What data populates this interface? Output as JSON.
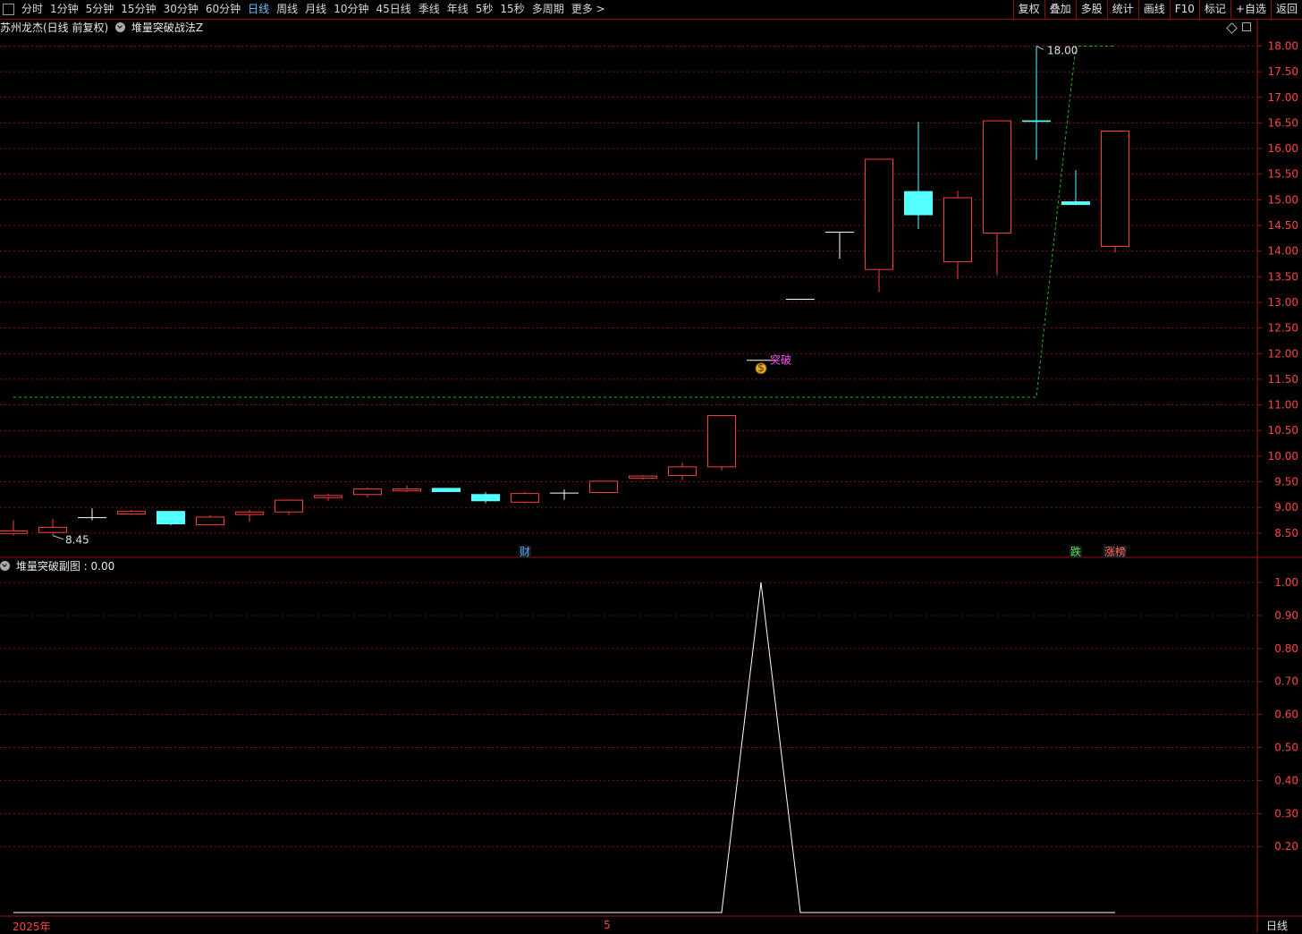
{
  "toolbar": {
    "periods": [
      "分时",
      "1分钟",
      "5分钟",
      "15分钟",
      "30分钟",
      "60分钟",
      "日线",
      "周线",
      "月线",
      "10分钟",
      "45日线",
      "季线",
      "年线",
      "5秒",
      "15秒",
      "多周期",
      "更多 >"
    ],
    "active_period": "日线",
    "right_buttons": [
      "复权",
      "叠加",
      "多股",
      "统计",
      "画线",
      "F10",
      "标记",
      "+自选",
      "返回"
    ]
  },
  "main_panel": {
    "title": "苏州龙杰(日线 前复权)",
    "indicator": "堆量突破战法Z",
    "marker_text": "突破",
    "high_label": "18.00",
    "low_label": "8.45",
    "event_tags": [
      {
        "text": "财",
        "color": "#5aa0ff"
      },
      {
        "text": "跌",
        "color": "#55dd55"
      },
      {
        "text": "涨榜",
        "color": "#ff6666"
      }
    ]
  },
  "sub_panel": {
    "title": "堆量突破副图",
    "value": ": 0.00"
  },
  "x_axis": {
    "labels": [
      "2025年",
      "5"
    ],
    "period_label": "日线"
  },
  "colors": {
    "up": "#ff3b3b",
    "down": "#54ffff",
    "flat": "#ffffff",
    "grid": "#7a1515",
    "border": "#a01010",
    "guide": "#22bb22",
    "signal": "#ff55ff"
  },
  "chart_data": [
    {
      "type": "candlestick",
      "ylim": [
        8.2,
        18.2
      ],
      "y_ticks": [
        8.5,
        9.0,
        9.5,
        10.0,
        10.5,
        11.0,
        11.5,
        12.0,
        12.5,
        13.0,
        13.5,
        14.0,
        14.5,
        15.0,
        15.5,
        16.0,
        16.5,
        17.0,
        17.5,
        18.0
      ],
      "candles": [
        {
          "o": 8.5,
          "h": 8.75,
          "l": 8.45,
          "c": 8.55
        },
        {
          "o": 8.52,
          "h": 8.78,
          "l": 8.45,
          "c": 8.62
        },
        {
          "o": 8.8,
          "h": 8.98,
          "l": 8.75,
          "c": 8.8
        },
        {
          "o": 8.88,
          "h": 8.95,
          "l": 8.85,
          "c": 8.93
        },
        {
          "o": 8.93,
          "h": 8.93,
          "l": 8.65,
          "c": 8.67
        },
        {
          "o": 8.67,
          "h": 8.85,
          "l": 8.65,
          "c": 8.82
        },
        {
          "o": 8.87,
          "h": 8.95,
          "l": 8.72,
          "c": 8.92
        },
        {
          "o": 8.92,
          "h": 9.15,
          "l": 8.85,
          "c": 9.15
        },
        {
          "o": 9.2,
          "h": 9.27,
          "l": 9.13,
          "c": 9.24
        },
        {
          "o": 9.26,
          "h": 9.39,
          "l": 9.2,
          "c": 9.37
        },
        {
          "o": 9.33,
          "h": 9.43,
          "l": 9.3,
          "c": 9.37
        },
        {
          "o": 9.38,
          "h": 9.38,
          "l": 9.3,
          "c": 9.3
        },
        {
          "o": 9.26,
          "h": 9.3,
          "l": 9.08,
          "c": 9.12
        },
        {
          "o": 9.11,
          "h": 9.3,
          "l": 9.08,
          "c": 9.28
        },
        {
          "o": 9.28,
          "h": 9.35,
          "l": 9.15,
          "c": 9.28
        },
        {
          "o": 9.3,
          "h": 9.52,
          "l": 9.29,
          "c": 9.52
        },
        {
          "o": 9.58,
          "h": 9.63,
          "l": 9.54,
          "c": 9.62
        },
        {
          "o": 9.63,
          "h": 9.88,
          "l": 9.53,
          "c": 9.8
        },
        {
          "o": 9.8,
          "h": 10.8,
          "l": 9.72,
          "c": 10.8
        },
        {
          "o": 11.87,
          "h": 11.87,
          "l": 11.87,
          "c": 11.87
        },
        {
          "o": 13.06,
          "h": 13.06,
          "l": 13.06,
          "c": 13.06
        },
        {
          "o": 14.37,
          "h": 14.37,
          "l": 13.85,
          "c": 14.37
        },
        {
          "o": 13.65,
          "h": 15.8,
          "l": 13.2,
          "c": 15.8
        },
        {
          "o": 15.17,
          "h": 16.52,
          "l": 14.43,
          "c": 14.7
        },
        {
          "o": 13.8,
          "h": 15.18,
          "l": 13.45,
          "c": 15.05
        },
        {
          "o": 14.36,
          "h": 16.55,
          "l": 13.53,
          "c": 16.55
        },
        {
          "o": 16.55,
          "h": 18.0,
          "l": 15.78,
          "c": 16.52
        },
        {
          "o": 14.97,
          "h": 15.58,
          "l": 14.9,
          "c": 14.9
        },
        {
          "o": 14.1,
          "h": 16.35,
          "l": 13.97,
          "c": 16.35
        }
      ],
      "guide_line": {
        "x": [
          0,
          26,
          27,
          28
        ],
        "y": [
          11.15,
          11.15,
          18.0,
          18.0
        ]
      },
      "signal_index": 19
    },
    {
      "type": "line",
      "series": [
        {
          "name": "堆量突破副图",
          "values": [
            0,
            0,
            0,
            0,
            0,
            0,
            0,
            0,
            0,
            0,
            0,
            0,
            0,
            0,
            0,
            0,
            0,
            0,
            0,
            1,
            0,
            0,
            0,
            0,
            0,
            0,
            0,
            0,
            0
          ]
        }
      ],
      "ylim": [
        0,
        1.03
      ],
      "y_ticks": [
        0.2,
        0.3,
        0.4,
        0.5,
        0.6,
        0.7,
        0.8,
        0.9,
        1.0
      ]
    }
  ]
}
